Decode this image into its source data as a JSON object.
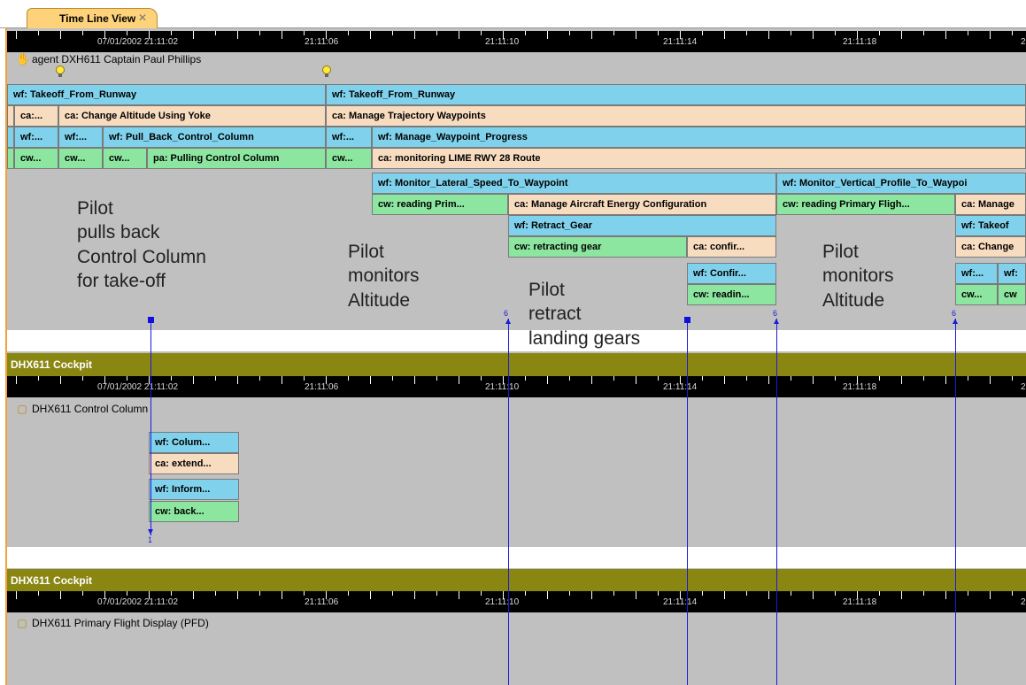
{
  "tab": {
    "label": "Time Line View",
    "close": "✕"
  },
  "ruler_labels": [
    "07/01/2002 21:11:02",
    "21:11:06",
    "21:11:10",
    "21:11:14",
    "21:11:18",
    "2"
  ],
  "agent_section": {
    "title": "agent DXH611 Captain Paul Phillips",
    "icon": "hand-icon"
  },
  "agent_rows": {
    "r1": [
      "wf: Takeoff_From_Runway",
      "wf: Takeoff_From_Runway"
    ],
    "r2": [
      "ca:...",
      "ca: Change Altitude Using Yoke",
      "ca: Manage Trajectory Waypoints"
    ],
    "r3": [
      "wf:...",
      "wf:...",
      "wf: Pull_Back_Control_Column",
      "wf:...",
      "wf: Manage_Waypoint_Progress"
    ],
    "r4": [
      "cw...",
      "cw...",
      "cw...",
      "pa: Pulling Control Column",
      "cw...",
      "ca: monitoring LIME RWY 28 Route"
    ],
    "r5": [
      "wf: Monitor_Lateral_Speed_To_Waypoint",
      "wf: Monitor_Vertical_Profile_To_Waypoi"
    ],
    "r6": [
      "cw: reading Prim...",
      "ca: Manage Aircraft Energy Configuration",
      "cw: reading Primary Fligh...",
      "ca: Manage"
    ],
    "r7": [
      "wf: Retract_Gear",
      "wf: Takeof"
    ],
    "r8": [
      "cw: retracting gear",
      "ca: confir...",
      "ca: Change"
    ],
    "r9": [
      "wf: Confir...",
      "wf:...",
      "wf:"
    ],
    "r10": [
      "cw: readin...",
      "cw...",
      "cw"
    ]
  },
  "annotations": {
    "a1": "Pilot\npulls back\nControl Column\nfor take-off",
    "a2": "Pilot\nmonitors\nAltitude",
    "a3": "Pilot\nretract\nlanding gears",
    "a4": "Pilot\nmonitors\nAltitude"
  },
  "cockpit_1": {
    "header": "DHX611 Cockpit",
    "title": "DHX611 Control Column",
    "icon": "cube-icon",
    "rows": [
      "wf: Colum...",
      "ca: extend...",
      "wf: Inform...",
      "cw: back..."
    ]
  },
  "cockpit_2": {
    "header": "DHX611 Cockpit",
    "title": "DHX611 Primary Flight Display (PFD)",
    "icon": "cube-icon"
  },
  "markers": {
    "m1": "1",
    "m6": "6"
  },
  "colors": {
    "workframe": "#80d2ec",
    "activity": "#f8dcc0",
    "communication": "#8ce6a0",
    "cockpit_bar": "#8a8612",
    "link": "#1a1adf",
    "tab": "#fdd27a"
  }
}
